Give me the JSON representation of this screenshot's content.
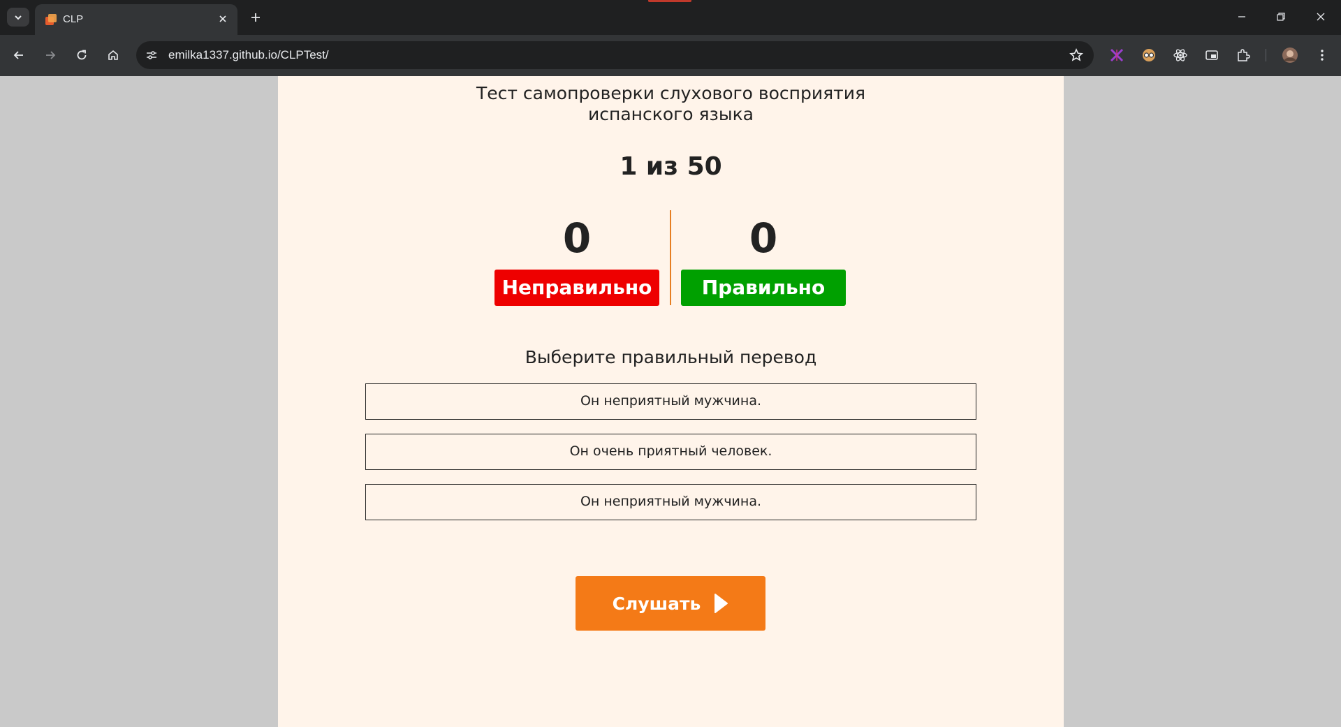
{
  "browser": {
    "tab": {
      "title": "CLP"
    },
    "url": "emilka1337.github.io/CLPTest/"
  },
  "page": {
    "title_line1": "Тест самопроверки слухового восприятия",
    "title_line2": "испанского языка",
    "progress": "1 из 50",
    "score": {
      "wrong_count": "0",
      "wrong_label": "Неправильно",
      "right_count": "0",
      "right_label": "Правильно"
    },
    "prompt": "Выберите правильный перевод",
    "options": [
      "Он неприятный мужчина.",
      "Он очень приятный человек.",
      "Он неприятный мужчина."
    ],
    "listen_label": "Слушать"
  },
  "colors": {
    "wrong": "#ee0000",
    "right": "#00a000",
    "accent": "#f47a17",
    "page_bg": "#fff4ea"
  }
}
